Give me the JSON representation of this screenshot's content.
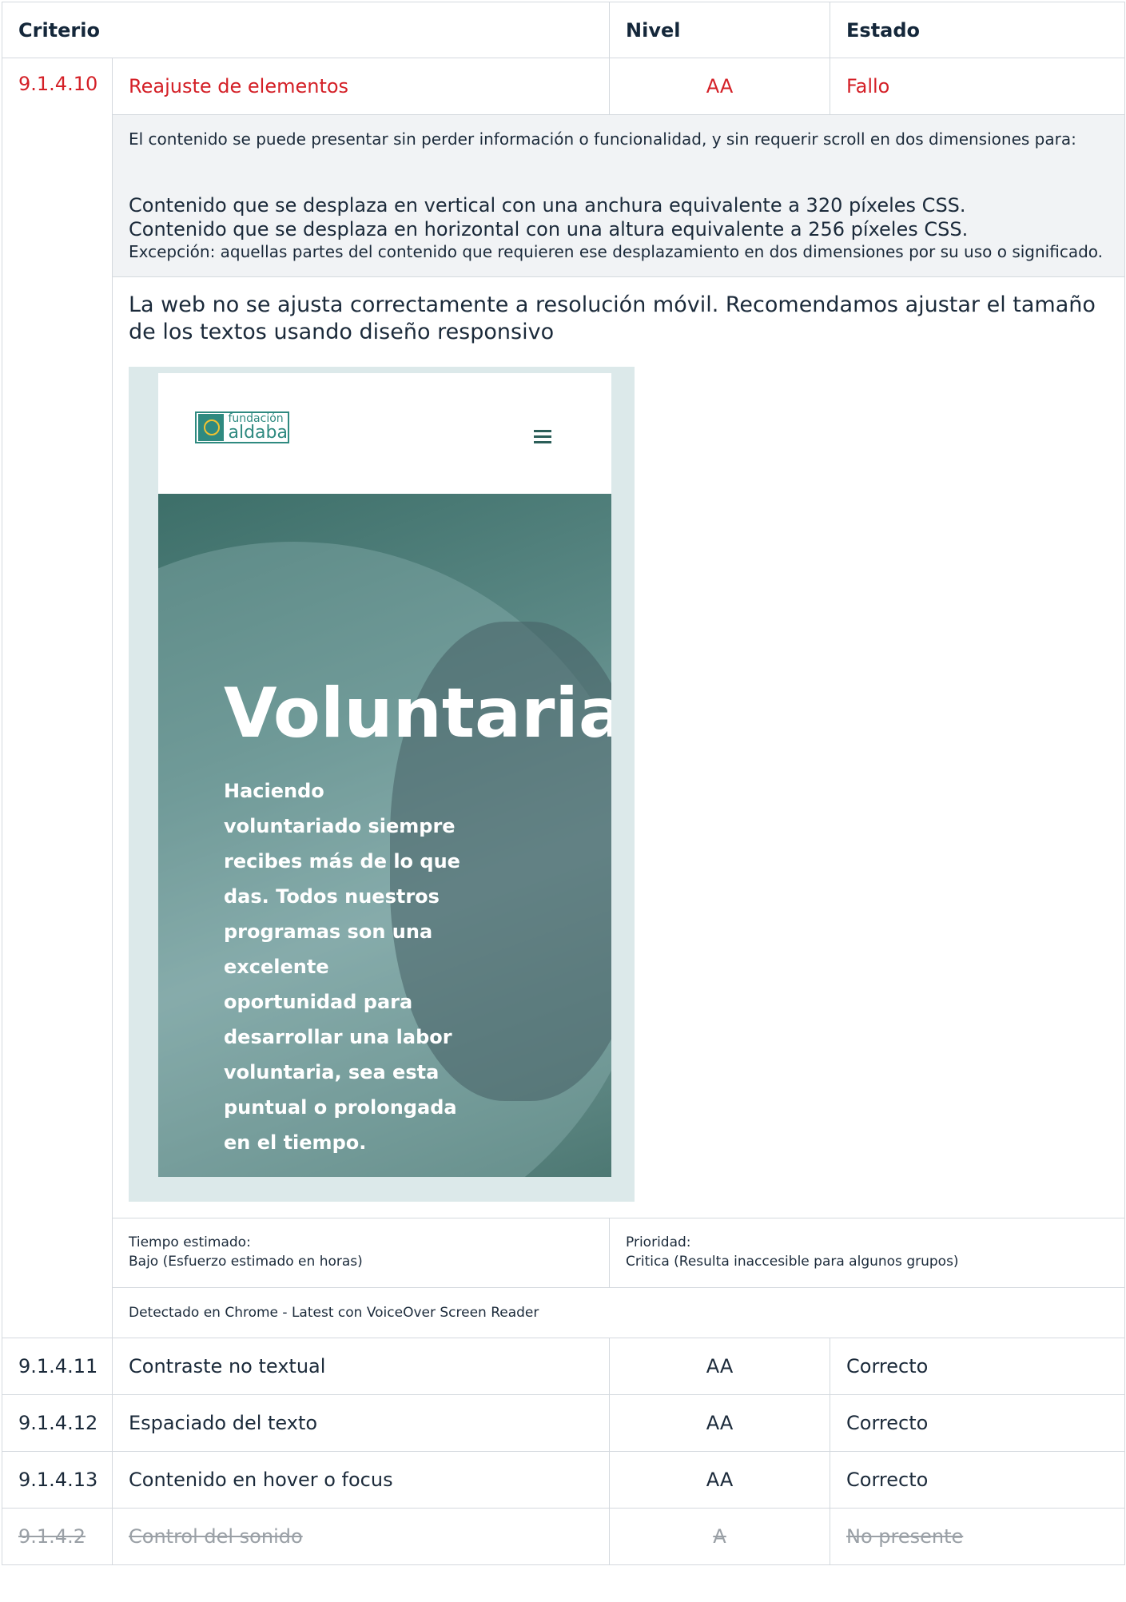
{
  "header": {
    "criterion": "Criterio",
    "level": "Nivel",
    "state": "Estado"
  },
  "failing": {
    "id": "9.1.4.10",
    "name": "Reajuste de elementos",
    "level": "AA",
    "state": "Fallo",
    "description": {
      "intro": "El contenido se puede presentar sin perder información o funcionalidad, y sin requerir scroll en dos dimensiones para:",
      "line1": "Contenido que se desplaza en vertical con una anchura equivalente a 320 píxeles CSS.",
      "line2": "Contenido que se desplaza en horizontal con una altura equivalente a 256 píxeles CSS.",
      "exception": "Excepción: aquellas partes del contenido que requieren ese desplazamiento en dos dimensiones por su uso o significado."
    },
    "note": "La web no se ajusta correctamente a resolución móvil. Recomendamos ajustar el tamaño de los textos usando diseño responsivo",
    "screenshot": {
      "logo_small": "fundación",
      "logo_big": "aldaba",
      "hero_title": "Voluntariado",
      "hero_copy": "Haciendo voluntariado siempre recibes más de lo que das. Todos nuestros programas son una excelente oportunidad para desarrollar una labor voluntaria, sea esta puntual o prolongada en el tiempo."
    },
    "time_label": "Tiempo estimado:",
    "time_value": "Bajo (Esfuerzo estimado en horas)",
    "priority_label": "Prioridad:",
    "priority_value": "Critica (Resulta inaccesible para algunos grupos)",
    "detected": "Detectado en Chrome - Latest con VoiceOver Screen Reader"
  },
  "rows": [
    {
      "id": "9.1.4.11",
      "name": "Contraste no textual",
      "level": "AA",
      "state": "Correcto"
    },
    {
      "id": "9.1.4.12",
      "name": "Espaciado del texto",
      "level": "AA",
      "state": "Correcto"
    },
    {
      "id": "9.1.4.13",
      "name": "Contenido en hover o focus",
      "level": "AA",
      "state": "Correcto"
    },
    {
      "id": "9.1.4.2",
      "name": "Control del sonido",
      "level": "A",
      "state": "No presente"
    }
  ],
  "colors": {
    "fail": "#d42027",
    "absent": "#9aa0a6",
    "accent": "#2f8a80"
  }
}
